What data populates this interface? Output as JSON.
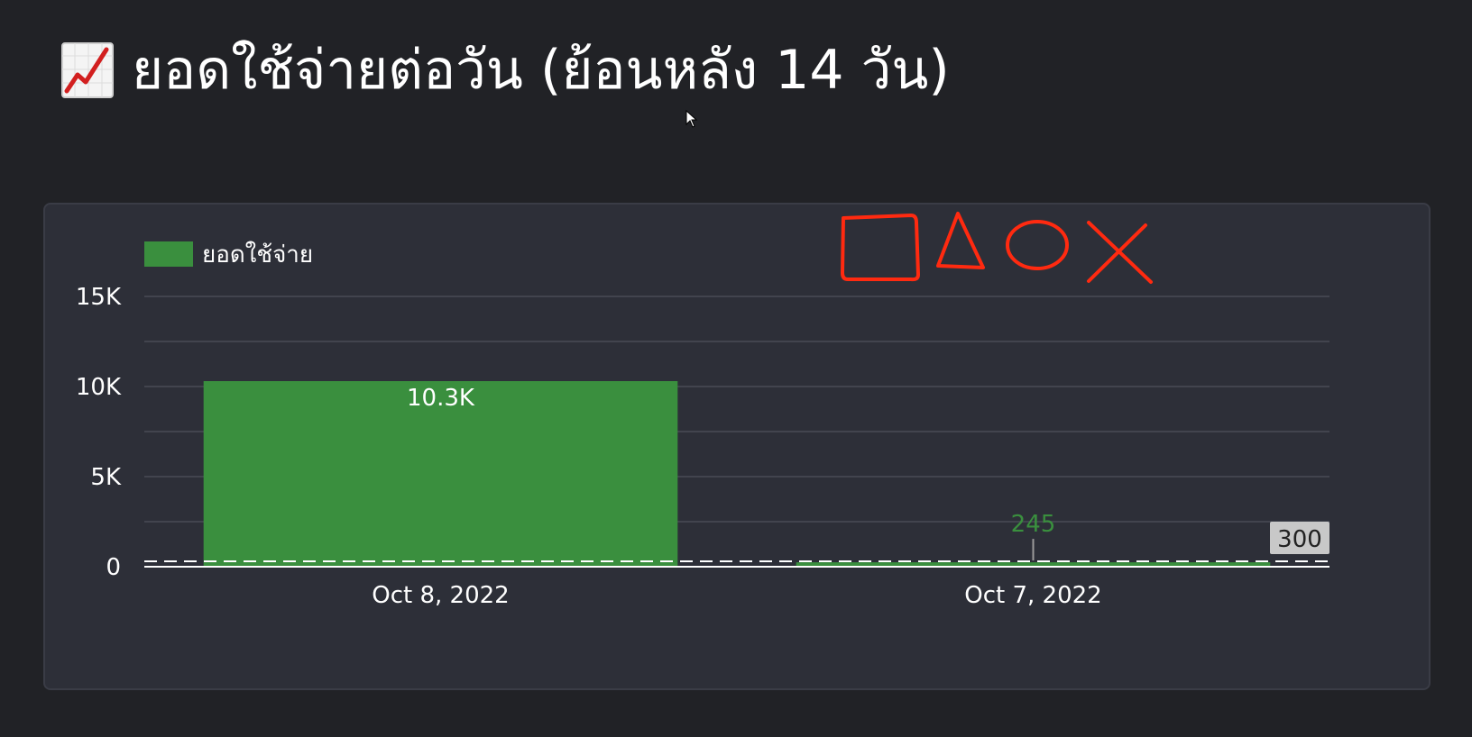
{
  "page": {
    "title": "ยอดใช้จ่ายต่อวัน (ย้อนหลัง 14 วัน)",
    "title_icon": "chart-increasing-icon"
  },
  "colors": {
    "background": "#212226",
    "card": "#2d2f38",
    "bar": "#3a8f3e",
    "label_green": "#3a8f3e",
    "grid": "#42444e",
    "reference_line": "#ffffff",
    "reference_badge": "#c8c8c8",
    "annotation": "#ff2a10"
  },
  "chart_data": {
    "type": "bar",
    "categories": [
      "Oct 8, 2022",
      "Oct 7, 2022"
    ],
    "series": [
      {
        "name": "ยอดใช้จ่าย",
        "values": [
          10300,
          245
        ],
        "data_labels": [
          "10.3K",
          "245"
        ]
      }
    ],
    "ylim": [
      0,
      15000
    ],
    "y_ticks": [
      0,
      5000,
      10000,
      15000
    ],
    "y_tick_labels": [
      "0",
      "5K",
      "10K",
      "15K"
    ],
    "grid": true,
    "legend_position": "top-left",
    "reference_line": {
      "value": 300,
      "label": "300",
      "style": "dashed"
    },
    "annotations": [
      "square",
      "triangle",
      "circle",
      "x"
    ]
  }
}
